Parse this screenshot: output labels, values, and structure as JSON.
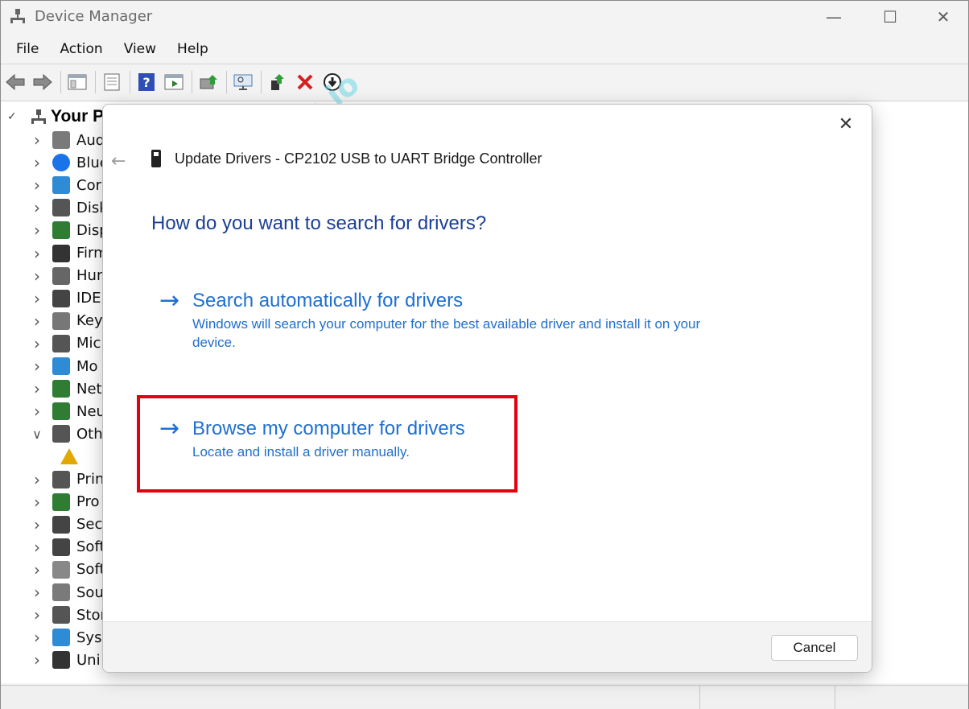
{
  "window": {
    "title": "Device Manager",
    "controls": {
      "minimize": "—",
      "maximize": "☐",
      "close": "✕"
    }
  },
  "menu": [
    "File",
    "Action",
    "View",
    "Help"
  ],
  "toolbar": {
    "icons": [
      "back-arrow-icon",
      "forward-arrow-icon",
      "show-hide-tree-icon",
      "properties-icon",
      "help-icon",
      "run-icon",
      "update-driver-icon",
      "scan-hardware-icon",
      "enable-device-icon",
      "uninstall-device-icon",
      "download-icon"
    ],
    "colors": {
      "uninstall": "#d71f1f",
      "help": "#2f4fb5"
    }
  },
  "tree": {
    "root_label": "Your PC",
    "items": [
      {
        "label": "Aud",
        "icon": "speaker-icon",
        "color": "#7a7a7a",
        "expanded": false
      },
      {
        "label": "Blue",
        "icon": "bluetooth-icon",
        "color": "#1a73e8",
        "expanded": false
      },
      {
        "label": "Cor",
        "icon": "monitor-icon",
        "color": "#2e8bd6",
        "expanded": false
      },
      {
        "label": "Disk",
        "icon": "disk-icon",
        "color": "#555555",
        "expanded": false
      },
      {
        "label": "Disp",
        "icon": "display-adapter-icon",
        "color": "#2e7d32",
        "expanded": false
      },
      {
        "label": "Firm",
        "icon": "firmware-icon",
        "color": "#333333",
        "expanded": false
      },
      {
        "label": "Hun",
        "icon": "hid-icon",
        "color": "#666666",
        "expanded": false
      },
      {
        "label": "IDE",
        "icon": "ide-icon",
        "color": "#444444",
        "expanded": false
      },
      {
        "label": "Key",
        "icon": "keyboard-icon",
        "color": "#777777",
        "expanded": false
      },
      {
        "label": "Mic",
        "icon": "mouse-icon",
        "color": "#555555",
        "expanded": false
      },
      {
        "label": "Mo",
        "icon": "monitor-icon",
        "color": "#2e8bd6",
        "expanded": false
      },
      {
        "label": "Net",
        "icon": "network-icon",
        "color": "#2e7d32",
        "expanded": false
      },
      {
        "label": "Neu",
        "icon": "chip-icon",
        "color": "#2e7d32",
        "expanded": false
      },
      {
        "label": "Oth",
        "icon": "other-devices-icon",
        "color": "#555555",
        "expanded": true
      },
      {
        "label": "",
        "icon": "warning-device-icon",
        "color": "#e0a800",
        "child": true
      },
      {
        "label": "Prin",
        "icon": "printer-icon",
        "color": "#555555",
        "expanded": false
      },
      {
        "label": "Pro",
        "icon": "processor-icon",
        "color": "#2e7d32",
        "expanded": false
      },
      {
        "label": "Sec",
        "icon": "security-icon",
        "color": "#444444",
        "expanded": false
      },
      {
        "label": "Soft",
        "icon": "software-component-icon",
        "color": "#444444",
        "expanded": false
      },
      {
        "label": "Soft",
        "icon": "software-device-icon",
        "color": "#888888",
        "expanded": false
      },
      {
        "label": "Sou",
        "icon": "speaker-icon",
        "color": "#7a7a7a",
        "expanded": false
      },
      {
        "label": "Stor",
        "icon": "storage-icon",
        "color": "#555555",
        "expanded": false
      },
      {
        "label": "Syst",
        "icon": "system-icon",
        "color": "#2e8bd6",
        "expanded": false
      },
      {
        "label": "Uni",
        "icon": "usb-icon",
        "color": "#333333",
        "expanded": false
      }
    ]
  },
  "dialog": {
    "header": "Update Drivers - CP2102 USB to UART Bridge Controller",
    "question": "How do you want to search for drivers?",
    "options": [
      {
        "title": "Search automatically for drivers",
        "description": "Windows will search your computer for the best available driver and install it on your device."
      },
      {
        "title": "Browse my computer for drivers",
        "description": "Locate and install a driver manually."
      }
    ],
    "arrow_glyph": "→",
    "cancel": "Cancel",
    "close_glyph": "✕",
    "back_glyph": "←",
    "accent_color": "#1f6fd1",
    "highlight_color": "#e3000f"
  },
  "watermark": "https://diyables.io"
}
